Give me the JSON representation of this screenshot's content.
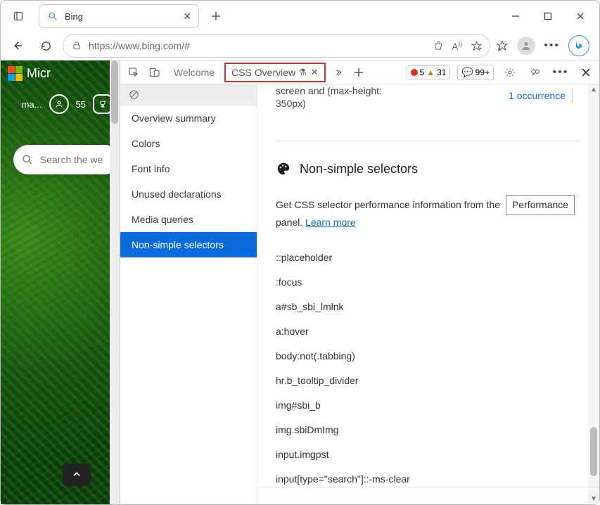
{
  "browser": {
    "tab_title": "Bing",
    "url": "https://www.bing.com/#"
  },
  "page": {
    "brand_partial": "Micr",
    "weather_partial": "ma...",
    "points": "55",
    "search_placeholder": "Search the we"
  },
  "devtools": {
    "tabs": {
      "welcome": "Welcome",
      "css_overview": "CSS Overview"
    },
    "status": {
      "errors": "5",
      "warnings": "31",
      "info": "99+"
    },
    "sidenav": {
      "overview": "Overview summary",
      "colors": "Colors",
      "font": "Font info",
      "unused": "Unused declarations",
      "media": "Media queries",
      "nonsimple": "Non-simple selectors"
    },
    "main": {
      "media_cut_l1": "screen and (max-height:",
      "media_cut_l2": "350px)",
      "occurrence_link": "1 occurrence",
      "section_title": "Non-simple selectors",
      "desc_1": "Get CSS selector performance information from the",
      "perf_btn": "Performance",
      "desc_2": "panel.",
      "learn_more": "Learn more",
      "selectors": [
        "::placeholder",
        ":focus",
        "a#sb_sbi_lmlnk",
        "a:hover",
        "body:not(.tabbing)",
        "hr.b_tooltip_divider",
        "img#sbi_b",
        "img.sbiDmImg",
        "input.imgpst",
        "input[type=\"search\"]::-ms-clear"
      ]
    }
  }
}
